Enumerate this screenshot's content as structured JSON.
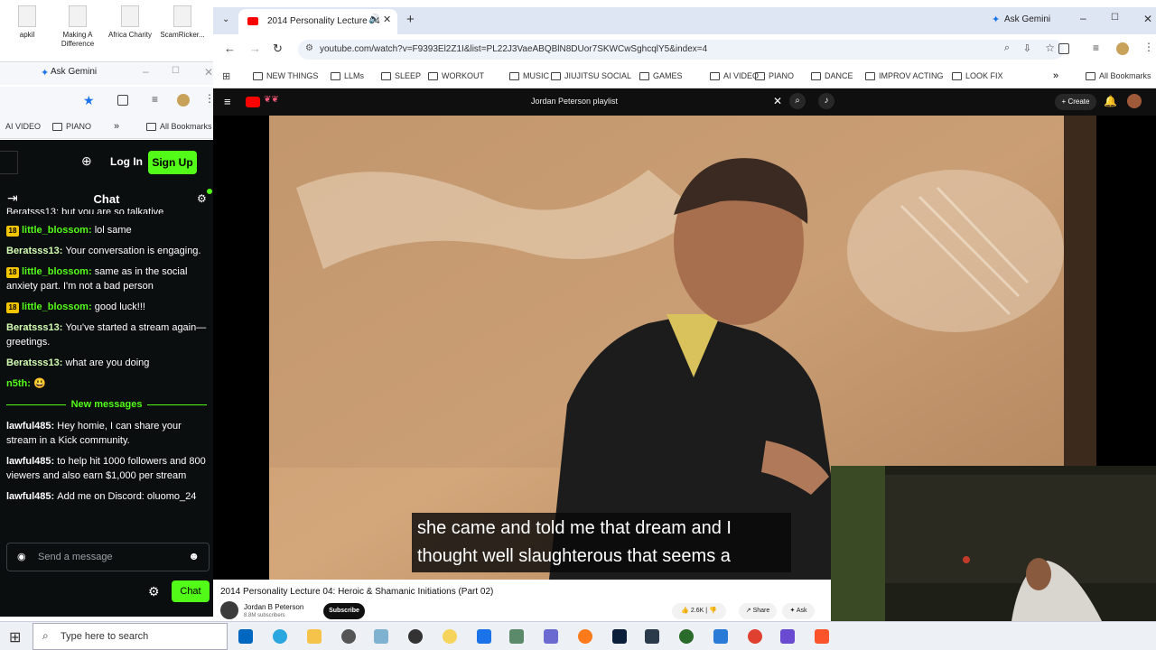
{
  "desktop": {
    "icons": [
      "apkil",
      "Making A Difference",
      "Africa Charity",
      "ScamRicker..."
    ]
  },
  "left_browser": {
    "gemini_label": "Ask Gemini",
    "bookmarks": [
      "AI VIDEO",
      "PIANO",
      "All Bookmarks"
    ]
  },
  "kick": {
    "login": "Log In",
    "signup": "Sign Up",
    "chat_title": "Chat",
    "cut_line": "Beratsss13: but you are so talkative",
    "messages": [
      {
        "badge": "18",
        "user": "little_blossom",
        "user_color": "green",
        "text": "lol same"
      },
      {
        "badge": "",
        "user": "Beratsss13",
        "user_color": "pink",
        "text": "Your conversation is engaging."
      },
      {
        "badge": "18",
        "user": "little_blossom",
        "user_color": "green",
        "text": "same as in the social anxiety part. I'm not a bad person"
      },
      {
        "badge": "18",
        "user": "little_blossom",
        "user_color": "green",
        "text": "good luck!!!"
      },
      {
        "badge": "",
        "user": "Beratsss13",
        "user_color": "pink",
        "text": "You've started a stream again—greetings."
      },
      {
        "badge": "",
        "user": "Beratsss13",
        "user_color": "pink",
        "text": "what are you doing"
      },
      {
        "badge": "",
        "user": "n5th",
        "user_color": "green",
        "text": "😃"
      }
    ],
    "new_messages_label": "New messages",
    "new_messages": [
      {
        "user": "lawful485",
        "text": "Hey homie, I can share your stream in a Kick community."
      },
      {
        "user": "lawful485",
        "text": "to help hit 1000 followers and 800 viewers and also earn $1,000 per stream"
      },
      {
        "user": "lawful485",
        "text": "Add me on Discord: oluomo_24"
      }
    ],
    "send_placeholder": "Send a message",
    "chat_button": "Chat"
  },
  "right_browser": {
    "tab_title": "2014 Personality Lecture 04",
    "gemini_label": "Ask Gemini",
    "url": "youtube.com/watch?v=F9393El2Z1I&list=PL22J3VaeABQBlN8DUor7SKWCwSghcqlY5&index=4",
    "bookmarks": [
      "NEW THINGS",
      "LLMs",
      "SLEEP",
      "WORKOUT",
      "MUSIC",
      "JIUJITSU SOCIAL",
      "GAMES",
      "AI VIDEO",
      "PIANO",
      "DANCE",
      "IMPROV ACTING",
      "LOOK FIX"
    ],
    "all_bookmarks": "All Bookmarks"
  },
  "youtube": {
    "search_query": "Jordan Peterson playlist",
    "create_label": "+ Create",
    "caption_line1": "she came and told me that dream and I",
    "caption_line2": "thought well slaughterous that seems a",
    "video_title": "2014 Personality Lecture 04: Heroic & Shamanic Initiations (Part 02)",
    "channel": "Jordan B Peterson",
    "subscribers": "8.8M subscribers",
    "subscribe": "Subscribe",
    "likes": "2.6K",
    "share": "Share",
    "ask": "Ask"
  },
  "taskbar": {
    "search_placeholder": "Type here to search"
  },
  "colors": {
    "kick_green": "#53fc18",
    "kick_bg": "#0b0e0f",
    "youtube_red": "#ff0000",
    "tab_strip": "#dfe6f3"
  }
}
